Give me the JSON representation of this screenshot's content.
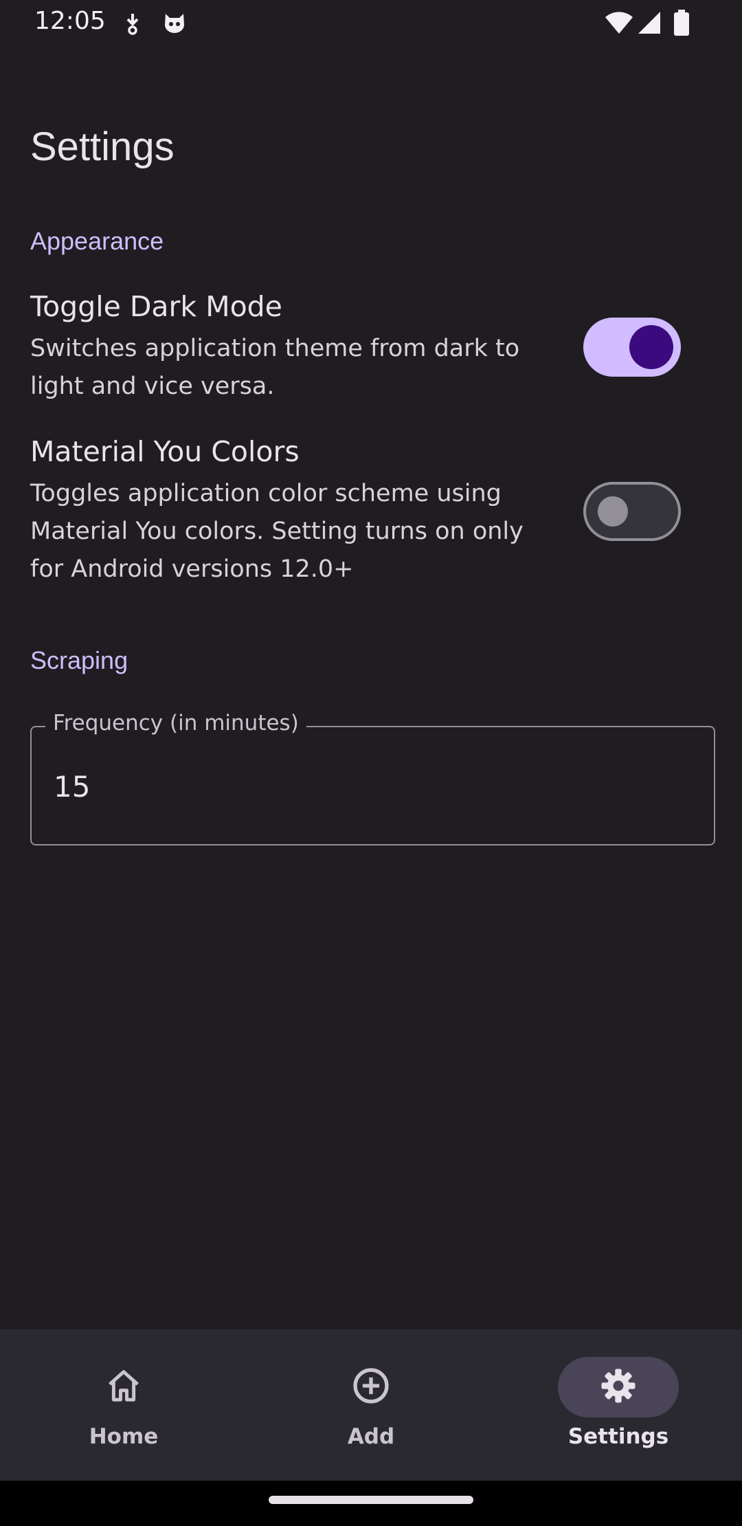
{
  "status_bar": {
    "time": "12:05",
    "icons": [
      "download-icon",
      "cat-notification-icon",
      "wifi-icon",
      "signal-icon",
      "battery-icon"
    ]
  },
  "page": {
    "title": "Settings"
  },
  "appearance": {
    "label": "Appearance",
    "dark_mode": {
      "title": "Toggle Dark Mode",
      "description": "Switches application theme from dark to light and vice versa.",
      "enabled": true
    },
    "material_you": {
      "title": "Material You Colors",
      "description": "Toggles application color scheme using Material You colors. Setting turns on only for Android versions 12.0+",
      "enabled": false
    }
  },
  "scraping": {
    "label": "Scraping",
    "frequency": {
      "label": "Frequency (in minutes)",
      "value": "15"
    }
  },
  "bottom_nav": {
    "items": [
      {
        "label": "Home",
        "icon": "home-icon",
        "active": false
      },
      {
        "label": "Add",
        "icon": "add-circle-icon",
        "active": false
      },
      {
        "label": "Settings",
        "icon": "gear-icon",
        "active": true
      }
    ]
  },
  "colors": {
    "accent": "#d0bcff",
    "background": "#1f1d21",
    "switch_on_thumb": "#3b0a7e",
    "nav_background": "#2b2930",
    "nav_active_indicator": "#4a4458"
  }
}
